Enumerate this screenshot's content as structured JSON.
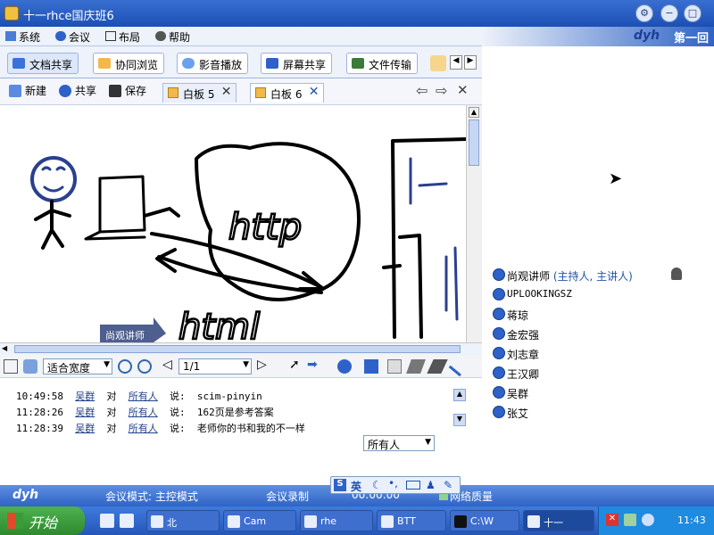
{
  "window": {
    "title": "十一rhce国庆班6"
  },
  "menu": {
    "items": [
      {
        "label": "系统"
      },
      {
        "label": "会议"
      },
      {
        "label": "布局"
      },
      {
        "label": "帮助"
      }
    ]
  },
  "brand": {
    "logo": "dyh",
    "label": "第一回"
  },
  "main_tabs": [
    {
      "label": "文档共享"
    },
    {
      "label": "协同浏览"
    },
    {
      "label": "影音播放"
    },
    {
      "label": "屏幕共享"
    },
    {
      "label": "文件传输"
    }
  ],
  "doc_toolbar": {
    "new": "新建",
    "share": "共享",
    "save": "保存",
    "tabs": [
      {
        "label": "白板 5"
      },
      {
        "label": "白板 6"
      }
    ]
  },
  "whiteboard": {
    "strokes": [
      {
        "text": "http"
      },
      {
        "text": "html"
      },
      {
        "text": "尚观讲师"
      }
    ]
  },
  "wb_toolbar": {
    "zoom_option": "适合宽度",
    "page": "1/1"
  },
  "chat": {
    "messages": [
      {
        "time": "10:49:58",
        "user": "吴群",
        "verb": "对",
        "target": "所有人",
        "say": "说:",
        "text": "scim-pinyin"
      },
      {
        "time": "11:28:26",
        "user": "吴群",
        "verb": "对",
        "target": "所有人",
        "say": "说:",
        "text": "162页是参考答案"
      },
      {
        "time": "11:28:39",
        "user": "吴群",
        "verb": "对",
        "target": "所有人",
        "say": "说:",
        "text": "老师你的书和我的不一样"
      }
    ],
    "recipient": "所有人"
  },
  "members": [
    {
      "name": "尚观讲师",
      "role": "(主持人, 主讲人)"
    },
    {
      "name": "UPLOOKINGSZ"
    },
    {
      "name": "蒋琼"
    },
    {
      "name": "金宏强"
    },
    {
      "name": "刘志章"
    },
    {
      "name": "王汉卿"
    },
    {
      "name": "吴群"
    },
    {
      "name": "张艾"
    }
  ],
  "status": {
    "logo": "dyh",
    "mode": "会议模式: 主控模式",
    "record": "会议录制",
    "time": "00:00:00",
    "network": "网络质量"
  },
  "ime": {
    "label": "英"
  },
  "taskbar": {
    "start": "开始",
    "tasks": [
      {
        "label": "北"
      },
      {
        "label": "Cam"
      },
      {
        "label": "rhe"
      },
      {
        "label": "BTT"
      },
      {
        "label": "C:\\W"
      },
      {
        "label": "十一"
      }
    ],
    "clock": "11:43"
  },
  "colors": {
    "title_bar": "#1c4fb4",
    "status_bar": "#2f63c5",
    "start": "#2d8a2d",
    "ink": "#000000",
    "link": "#224488"
  }
}
